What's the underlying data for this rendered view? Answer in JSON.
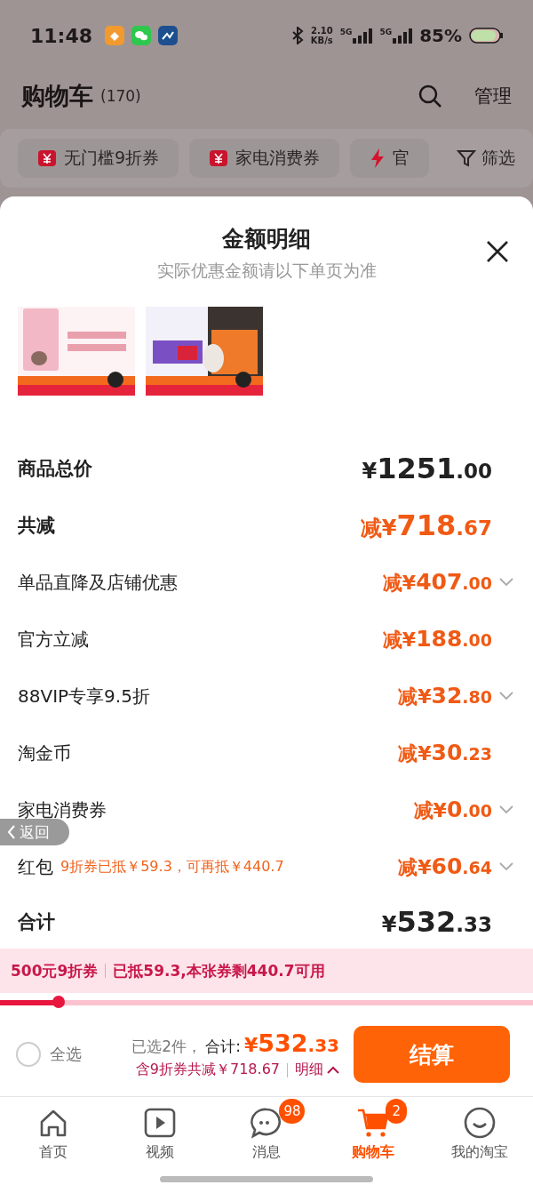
{
  "status_bar": {
    "time": "11:48",
    "speed_value": "2.10",
    "speed_unit": "KB/s",
    "network_1": "5G",
    "network_2": "5G",
    "battery_percent": "85%"
  },
  "header": {
    "title": "购物车",
    "count": "(170)",
    "manage": "管理"
  },
  "filter_chips": [
    {
      "label": "无门槛9折券",
      "kind": "coupon"
    },
    {
      "label": "家电消费券",
      "kind": "coupon"
    },
    {
      "label": "官",
      "kind": "flash"
    }
  ],
  "filter_button": "筛选",
  "sheet": {
    "title": "金额明细",
    "subtitle": "实际优惠金额请以下单页为准",
    "rows": [
      {
        "kind": "price",
        "label": "商品总价",
        "amount": "¥1251.00",
        "expandable": false
      },
      {
        "kind": "discount",
        "label": "共减",
        "amount": "减¥718.67",
        "expandable": false
      },
      {
        "kind": "item",
        "label": "单品直降及店铺优惠",
        "amount": "减¥407.00",
        "expandable": true
      },
      {
        "kind": "item",
        "label": "官方立减",
        "amount": "减¥188.00",
        "expandable": false
      },
      {
        "kind": "item",
        "label": "88VIP专享9.5折",
        "amount": "减¥32.80",
        "expandable": true
      },
      {
        "kind": "item",
        "label": "淘金币",
        "amount": "减¥30.23",
        "expandable": false
      },
      {
        "kind": "item",
        "label": "家电消费券",
        "amount": "减¥0.00",
        "expandable": true
      },
      {
        "kind": "item",
        "label": "红包",
        "note": "9折券已抵￥59.3，可再抵￥440.7",
        "amount": "减¥60.64",
        "expandable": true
      },
      {
        "kind": "total",
        "label": "合计",
        "amount": "¥532.33",
        "expandable": false
      }
    ]
  },
  "back_button": "返回",
  "coupon_bar": {
    "name": "500元9折券",
    "detail": "已抵59.3,本张券剩440.7可用",
    "level": 0.11
  },
  "checkout": {
    "select_all": {
      "label": "全选",
      "checked": false
    },
    "selected_count": "已选2件，",
    "total_label": "合计:",
    "total": "¥532.33",
    "discount": "含9折券共减￥718.67",
    "details": "明细",
    "button": "结算"
  },
  "tabs": [
    {
      "label": "首页",
      "selected": false
    },
    {
      "label": "视频",
      "selected": false
    },
    {
      "label": "消息",
      "badge": "98",
      "selected": false
    },
    {
      "label": "购物车",
      "badge": "2",
      "selected": true
    },
    {
      "label": "我的淘宝",
      "selected": false
    }
  ]
}
